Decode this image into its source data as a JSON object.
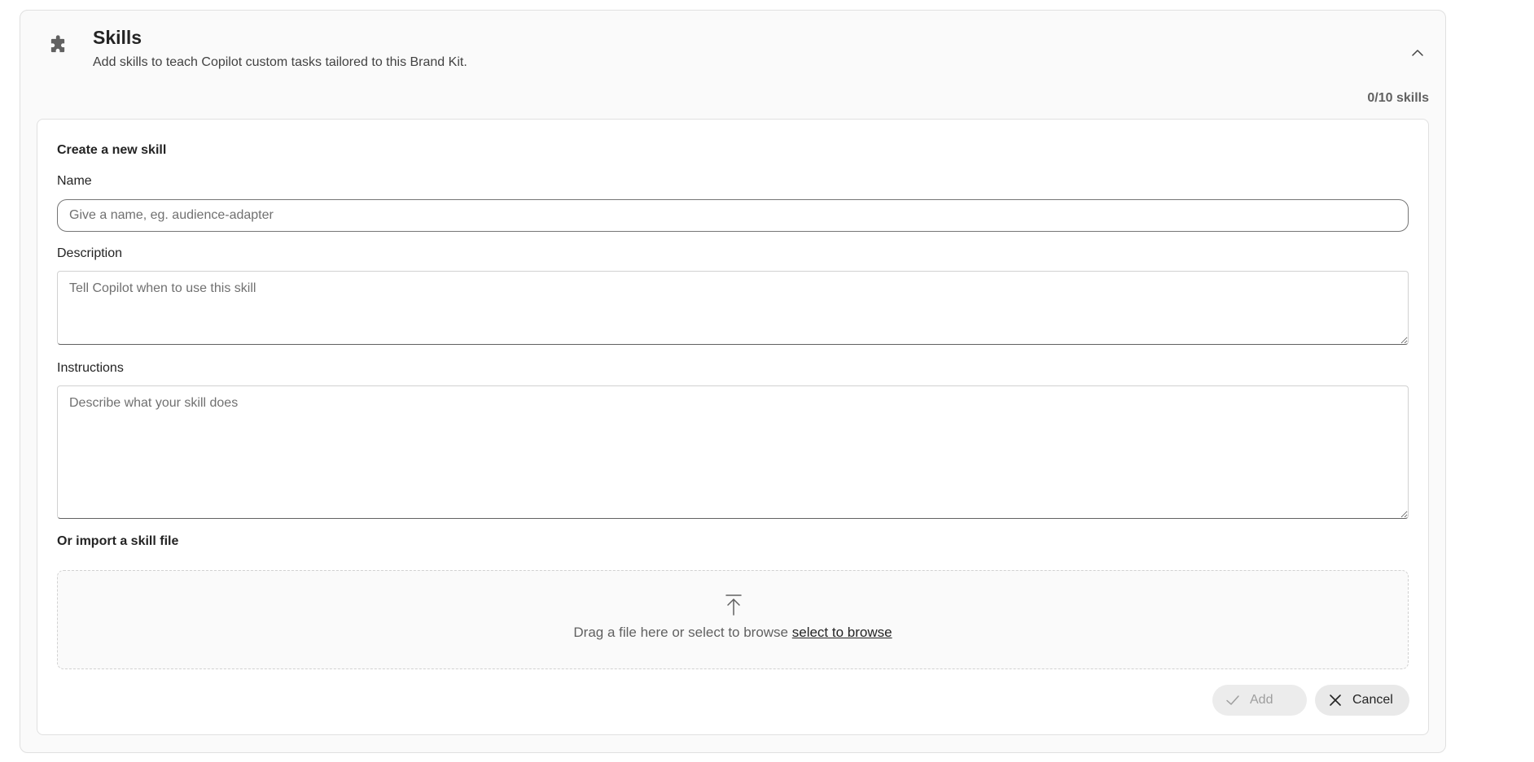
{
  "header": {
    "title": "Skills",
    "subtitle": "Add skills to teach Copilot custom tasks tailored to this Brand Kit.",
    "icon": "puzzle-icon",
    "collapse_icon": "chevron-up-icon"
  },
  "skills_count": "0/10 skills",
  "form": {
    "section_title": "Create a new skill",
    "name_label": "Name",
    "name_value": "",
    "name_placeholder": "Give a name, eg. audience-adapter",
    "description_label": "Description",
    "description_value": "",
    "description_placeholder": "Tell Copilot when to use this skill",
    "instructions_label": "Instructions",
    "instructions_value": "",
    "instructions_placeholder": "Describe what your skill does"
  },
  "import": {
    "title": "Or import a skill file",
    "drop_text": "Drag a file here or select to browse",
    "browse_link": "select to browse",
    "icon": "upload-icon"
  },
  "actions": {
    "add_label": "Add",
    "add_icon": "checkmark-icon",
    "add_disabled": true,
    "cancel_label": "Cancel",
    "cancel_icon": "close-icon"
  },
  "colors": {
    "card_background": "#fafafa",
    "border": "#e0e0e0",
    "text_primary": "#242424",
    "text_secondary": "#616161",
    "disabled_text": "#9e9e9e"
  }
}
